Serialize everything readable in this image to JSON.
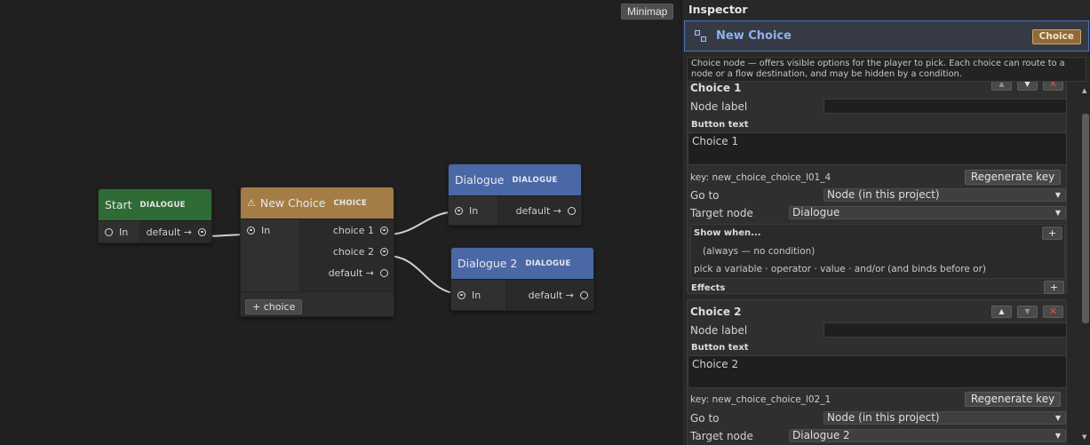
{
  "canvas": {
    "minimap_label": "Minimap",
    "nodes": {
      "start": {
        "title": "Start",
        "type": "DIALOGUE",
        "header_color": "#2e6b35",
        "in": "In",
        "out": "default →"
      },
      "choice": {
        "title": "New Choice",
        "type": "CHOICE",
        "header_color": "#a37d45",
        "warning_icon": "warning-icon",
        "in": "In",
        "outs": [
          "choice 1",
          "choice 2",
          "default →"
        ],
        "add_button": "+ choice"
      },
      "dialogue1": {
        "title": "Dialogue",
        "type": "DIALOGUE",
        "header_color": "#4a67a6",
        "in": "In",
        "out": "default →"
      },
      "dialogue2": {
        "title": "Dialogue 2",
        "type": "DIALOGUE",
        "header_color": "#4a67a6",
        "in": "In",
        "out": "default →"
      }
    }
  },
  "inspector": {
    "title": "Inspector",
    "node_icon": "node-graph-icon",
    "node_name": "New Choice",
    "type_badge": "Choice",
    "help_text": "Choice node — offers visible options for the player to pick. Each choice can route to a node or a flow destination, and may be hidden by a condition.",
    "choices": [
      {
        "title": "Choice 1",
        "node_label_label": "Node label",
        "node_label_value": "",
        "button_text_label": "Button text",
        "button_text_value": "Choice 1",
        "key": "key: new_choice_choice_l01_4",
        "regen_label": "Regenerate key",
        "goto_label": "Go to",
        "goto_value": "Node (in this project)",
        "target_label": "Target node",
        "target_value": "Dialogue",
        "show_when_label": "Show when...",
        "condition_text": "(always — no condition)",
        "condition_hint": "pick a variable · operator · value · and/or  (and binds before or)",
        "effects_label": "Effects",
        "plus": "+"
      },
      {
        "title": "Choice 2",
        "node_label_label": "Node label",
        "node_label_value": "",
        "button_text_label": "Button text",
        "button_text_value": "Choice 2",
        "key": "key: new_choice_choice_l02_1",
        "regen_label": "Regenerate key",
        "goto_label": "Go to",
        "goto_value": "Node (in this project)",
        "target_label": "Target node",
        "target_value": "Dialogue 2"
      }
    ],
    "ctl_icons": {
      "up": "▲",
      "down": "▼",
      "delete": "✕",
      "dropdown": "▼"
    },
    "accent": "#4a72b8"
  }
}
